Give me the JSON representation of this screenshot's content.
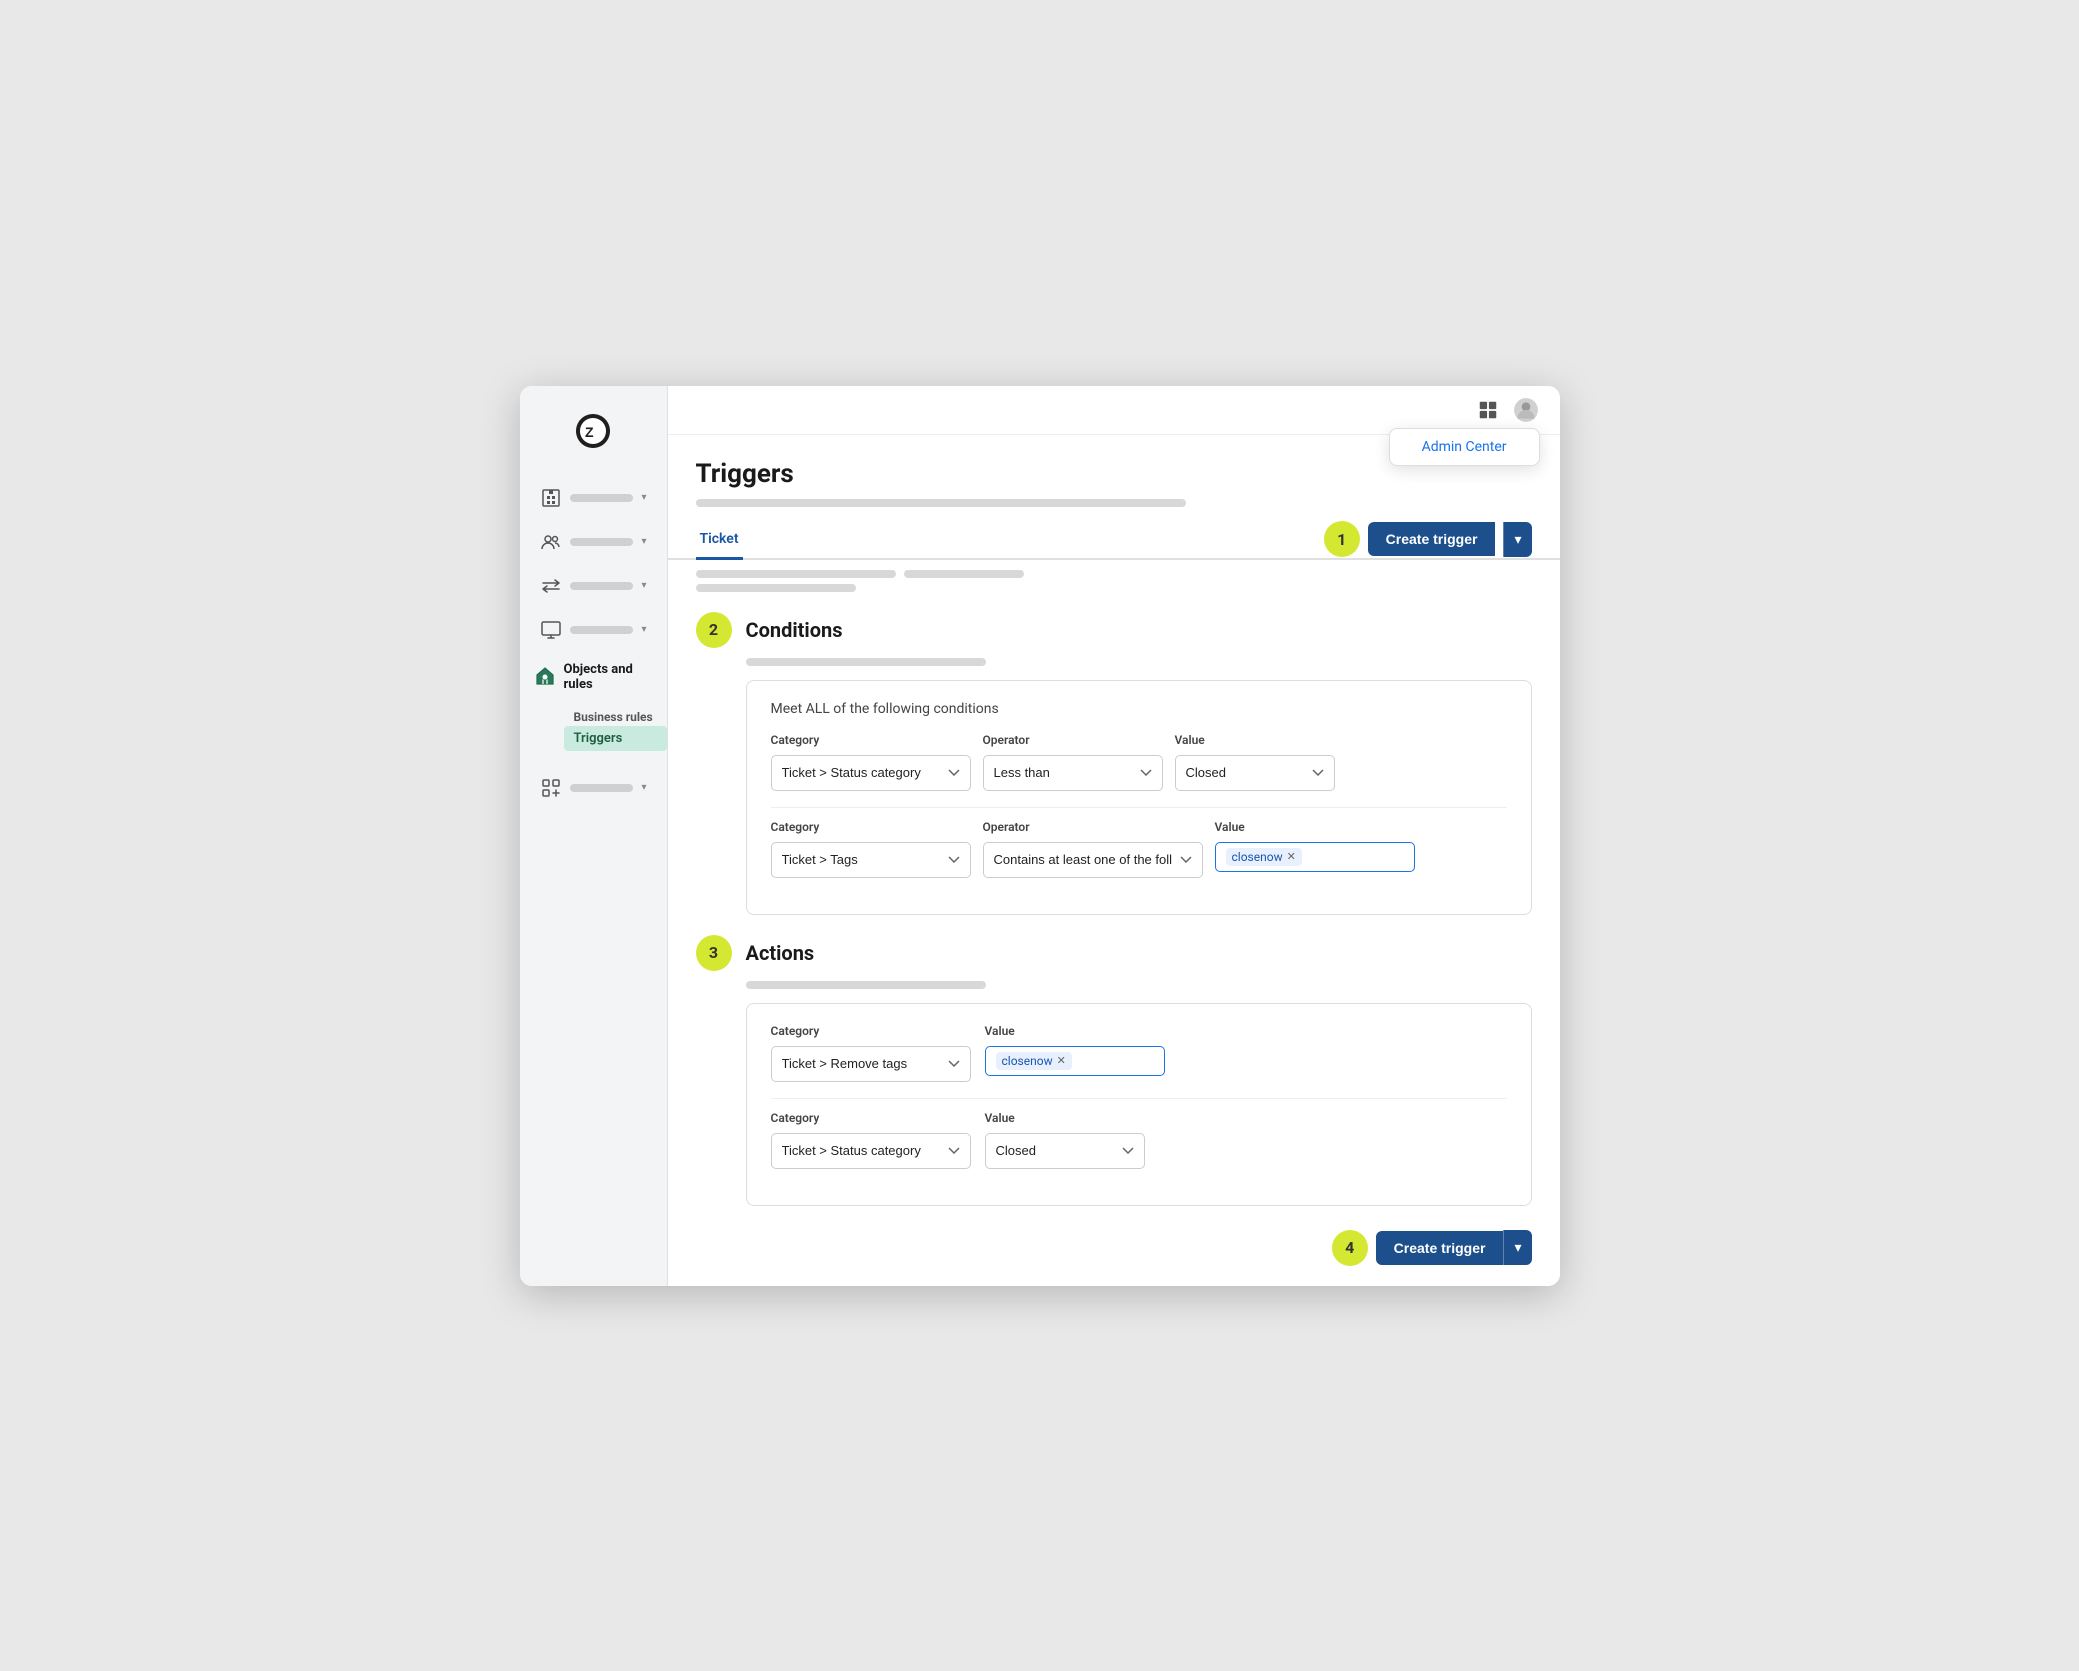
{
  "sidebar": {
    "nav_items": [
      {
        "icon": "building",
        "label": "",
        "has_chevron": true
      },
      {
        "icon": "people",
        "label": "",
        "has_chevron": true
      },
      {
        "icon": "arrows",
        "label": "",
        "has_chevron": true
      },
      {
        "icon": "monitor",
        "label": "",
        "has_chevron": true
      },
      {
        "icon": "objects",
        "label": "Objects and rules",
        "active": true,
        "has_chevron": false
      },
      {
        "icon": "grid-plus",
        "label": "",
        "has_chevron": true
      }
    ],
    "submenu": {
      "parent_label": "Business rules",
      "items": [
        {
          "label": "Triggers",
          "active": true
        }
      ]
    }
  },
  "topbar": {
    "admin_center_label": "Admin Center"
  },
  "page": {
    "title": "Triggers",
    "tabs": [
      {
        "label": "Ticket",
        "active": true
      }
    ]
  },
  "step1": {
    "badge": "1",
    "create_trigger_label": "Create trigger",
    "dropdown_label": "▾"
  },
  "step2": {
    "badge": "2",
    "section_title": "Conditions",
    "meet_label": "Meet ALL of the following conditions",
    "condition1": {
      "category_label": "Category",
      "category_value": "Ticket > Status category",
      "operator_label": "Operator",
      "operator_value": "Less than",
      "value_label": "Value",
      "value_value": "Closed"
    },
    "condition2": {
      "category_label": "Category",
      "category_value": "Ticket > Tags",
      "operator_label": "Operator",
      "operator_value": "Contains at least one of the following",
      "value_label": "Value",
      "tag": "closenow"
    }
  },
  "step3": {
    "badge": "3",
    "section_title": "Actions",
    "action1": {
      "category_label": "Category",
      "category_value": "Ticket > Remove tags",
      "value_label": "Value",
      "tag": "closenow"
    },
    "action2": {
      "category_label": "Category",
      "category_value": "Ticket > Status category",
      "value_label": "Value",
      "value_value": "Closed"
    }
  },
  "step4": {
    "badge": "4",
    "create_trigger_label": "Create trigger"
  }
}
